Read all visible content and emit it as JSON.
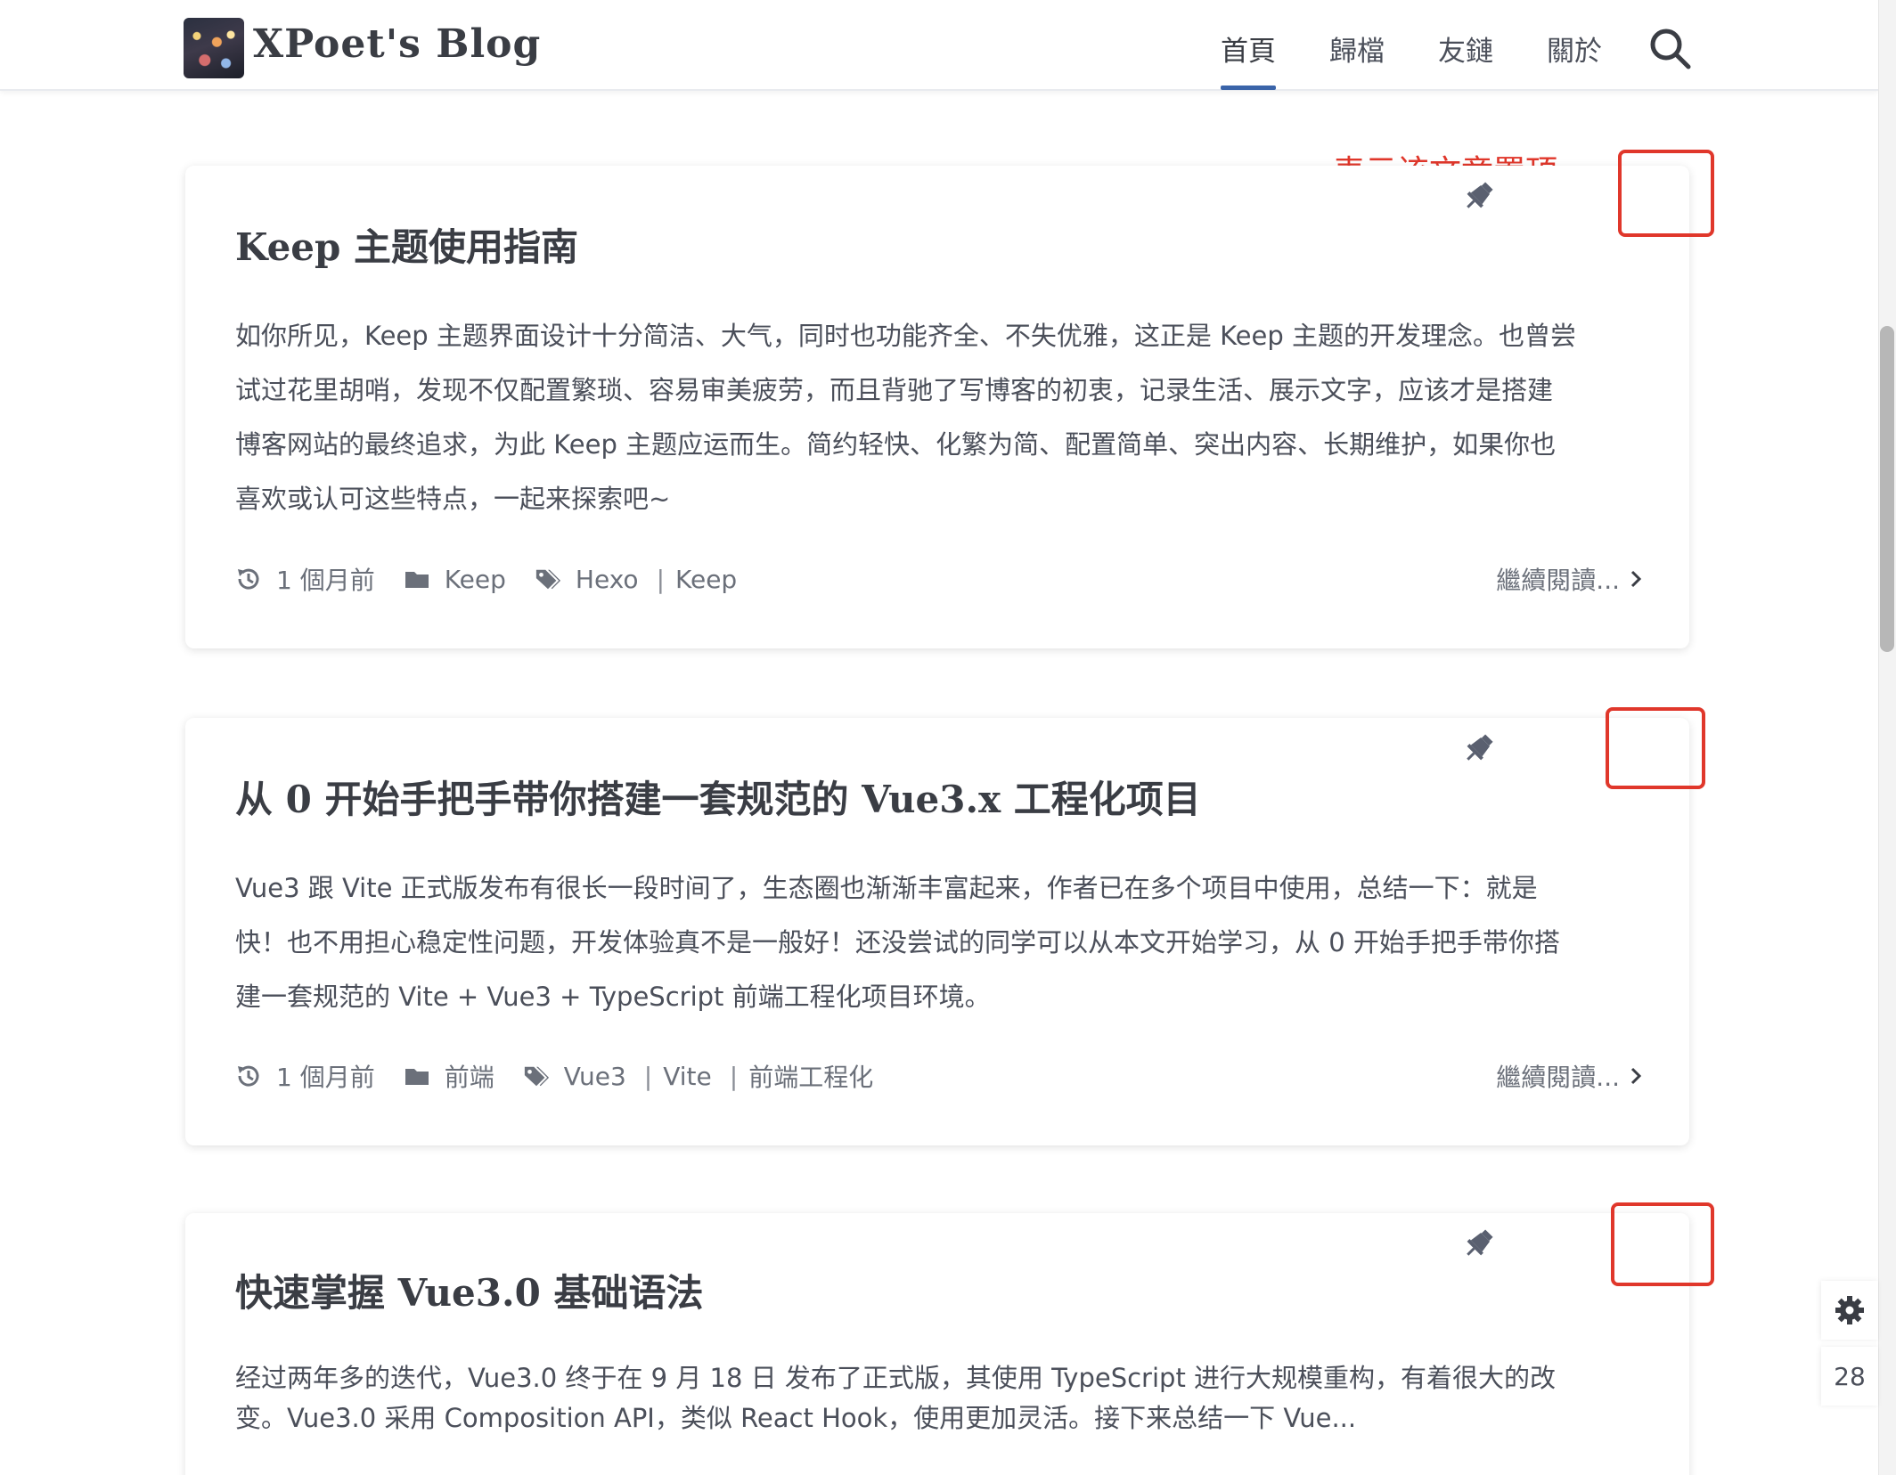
{
  "site": {
    "title": "XPoet's Blog"
  },
  "nav": {
    "items": [
      "首頁",
      "歸檔",
      "友鏈",
      "關於"
    ],
    "active": "首頁"
  },
  "annotation": {
    "label": "表示该文章置顶"
  },
  "posts": [
    {
      "title": "Keep 主题使用指南",
      "excerpt_lines": [
        "如你所见，Keep 主题界面设计十分简洁、大气，同时也功能齐全、不失优雅，这正是 Keep 主题的开发理念。也曾尝",
        "试过花里胡哨，发现不仅配置繁琐、容易审美疲劳，而且背驰了写博客的初衷，记录生活、展示文字，应该才是搭建",
        "博客网站的最终追求，为此 Keep 主题应运而生。简约轻快、化繁为简、配置简单、突出内容、长期维护，如果你也",
        "喜欢或认可这些特点，一起来探索吧~"
      ],
      "time": "1 個月前",
      "category": "Keep",
      "tags": [
        "Hexo",
        "Keep"
      ],
      "read_more": "繼續閱讀...",
      "pinned": true
    },
    {
      "title": "从 0 开始手把手带你搭建一套规范的 Vue3.x 工程化项目",
      "excerpt_lines": [
        "Vue3 跟 Vite 正式版发布有很长一段时间了，生态圈也渐渐丰富起来，作者已在多个项目中使用，总结一下：就是",
        "快！也不用担心稳定性问题，开发体验真不是一般好！还没尝试的同学可以从本文开始学习，从 0 开始手把手带你搭",
        "建一套规范的 Vite + Vue3 + TypeScript 前端工程化项目环境。"
      ],
      "time": "1 個月前",
      "category": "前端",
      "tags": [
        "Vue3",
        "Vite",
        "前端工程化"
      ],
      "read_more": "繼續閱讀...",
      "pinned": true
    },
    {
      "title": "快速掌握 Vue3.0 基础语法",
      "excerpt_lines": [
        "经过两年多的迭代，Vue3.0 终于在 9 月 18 日 发布了正式版，其使用 TypeScript 进行大规模重构，有着很大的改",
        "变。Vue3.0 采用 Composition API，类似 React Hook，使用更加灵活。接下来总结一下 Vue..."
      ],
      "pinned": true
    }
  ],
  "tools": {
    "settings_icon": "gear-icon",
    "scroll_percent": "28"
  },
  "colors": {
    "accent": "#3a64a9",
    "annotation_red": "#e0372b",
    "text": "#4b4f5a",
    "title": "#3a3d44"
  }
}
